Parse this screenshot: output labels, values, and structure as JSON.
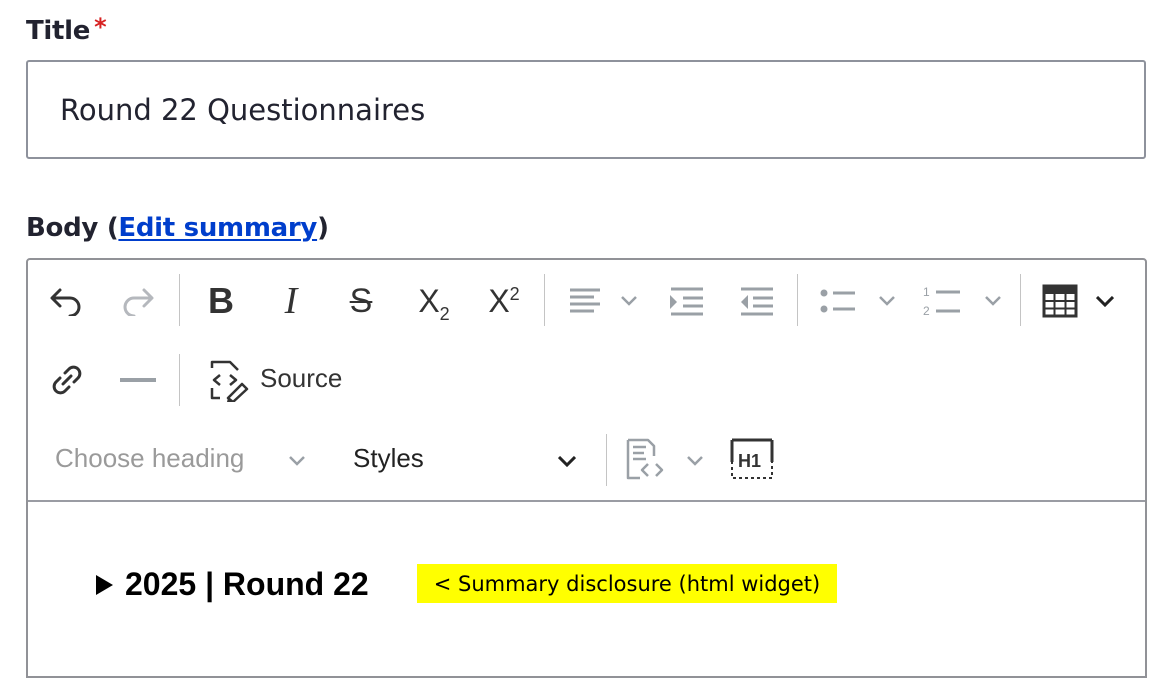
{
  "title_field": {
    "label": "Title",
    "required_mark": "*",
    "value": "Round 22 Questionnaires"
  },
  "body_field": {
    "label": "Body",
    "paren_open": "(",
    "edit_summary_link": "Edit summary",
    "paren_close": ")"
  },
  "toolbar": {
    "row1": [
      "undo-icon",
      "redo-icon",
      "bold-icon",
      "italic-icon",
      "strikethrough-icon",
      "subscript-icon",
      "superscript-icon",
      "align-left-icon",
      "indent-icon",
      "outdent-icon",
      "bulleted-list-icon",
      "numbered-list-icon",
      "table-icon"
    ],
    "row2": [
      "link-icon",
      "horizontal-line-icon",
      "source-icon"
    ],
    "source_label": "Source",
    "heading_placeholder": "Choose heading",
    "styles_label": "Styles",
    "row3": [
      "code-block-icon",
      "heading-h1-icon"
    ]
  },
  "content": {
    "summary_text": "2025 | Round 22",
    "annotation": "<  Summary disclosure (html widget)"
  },
  "colors": {
    "link": "#003ecc",
    "required": "#d72222",
    "highlight": "#ffff00",
    "disabled_icon": "#9aa0a6"
  }
}
